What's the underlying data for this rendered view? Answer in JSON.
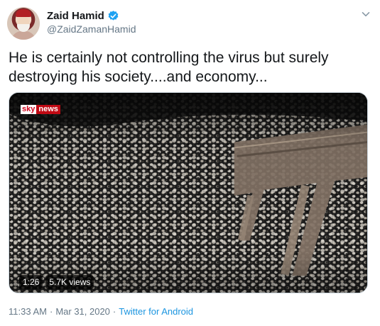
{
  "author": {
    "display_name": "Zaid Hamid",
    "handle": "@ZaidZamanHamid",
    "verified_icon": "verified-badge-icon"
  },
  "tweet": {
    "text": "He is certainly not controlling the virus but surely destroying his society....and economy..."
  },
  "media": {
    "logo_sky": "sky",
    "logo_news": "news",
    "duration": "1:26",
    "views": "5.7K views"
  },
  "meta": {
    "time": "11:33 AM",
    "separator": "·",
    "date": "Mar 31, 2020",
    "separator2": "·",
    "source": "Twitter for Android"
  },
  "colors": {
    "accent": "#1b95e0",
    "verified": "#1da1f2",
    "secondary_text": "#657786",
    "sky_red": "#c00a14"
  }
}
